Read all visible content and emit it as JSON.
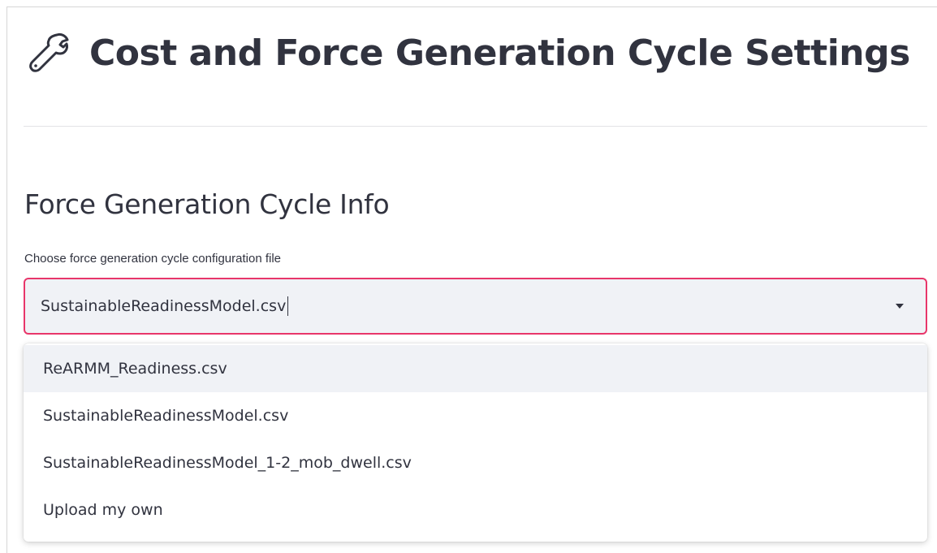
{
  "header": {
    "title": "Cost and Force Generation Cycle Settings",
    "icon": "wrench-icon"
  },
  "section": {
    "title": "Force Generation Cycle Info"
  },
  "config_select": {
    "label": "Choose force generation cycle configuration file",
    "value": "SustainableReadinessModel.csv",
    "options": [
      "ReARMM_Readiness.csv",
      "SustainableReadinessModel.csv",
      "SustainableReadinessModel_1-2_mob_dwell.csv",
      "Upload my own"
    ],
    "highlighted_option": "ReARMM_Readiness.csv",
    "focus_color": "#e8366a"
  },
  "colors": {
    "text": "#31333f",
    "input_bg": "#f0f2f6"
  }
}
